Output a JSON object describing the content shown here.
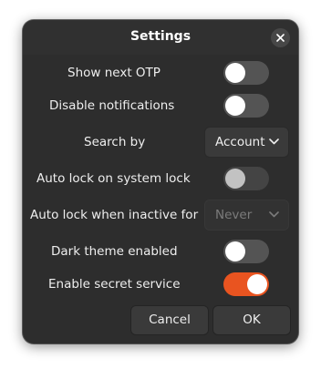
{
  "window": {
    "title": "Settings",
    "close_icon": "close-icon"
  },
  "settings": {
    "show_next_otp": {
      "label": "Show next OTP",
      "enabled": false
    },
    "disable_notifications": {
      "label": "Disable notifications",
      "enabled": false
    },
    "search_by": {
      "label": "Search by",
      "value": "Account",
      "icon": "chevron-down-icon"
    },
    "auto_lock_system": {
      "label": "Auto lock on system lock",
      "enabled": false,
      "sensitive": false
    },
    "auto_lock_inactive": {
      "label": "Auto lock when inactive for",
      "value": "Never",
      "sensitive": false,
      "icon": "chevron-down-icon"
    },
    "dark_theme": {
      "label": "Dark theme enabled",
      "enabled": false
    },
    "secret_service": {
      "label": "Enable secret service",
      "enabled": true
    }
  },
  "buttons": {
    "cancel": "Cancel",
    "ok": "OK"
  },
  "colors": {
    "accent": "#e95420",
    "dialog_bg": "#2d2d2d",
    "switch_off": "#545454",
    "button_bg": "#3a3a3a"
  }
}
